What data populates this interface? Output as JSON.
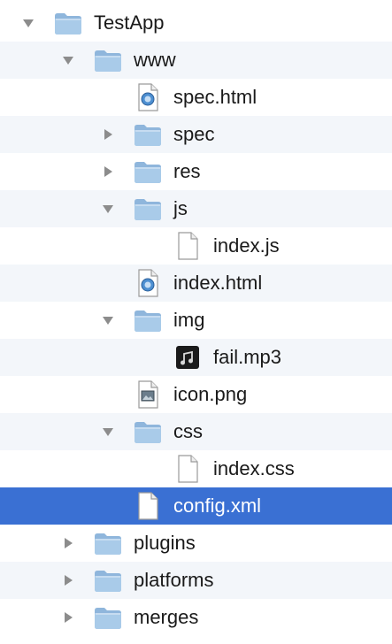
{
  "tree": [
    {
      "label": "TestApp",
      "level": 0,
      "kind": "folder",
      "state": "expanded"
    },
    {
      "label": "www",
      "level": 1,
      "kind": "folder",
      "state": "expanded"
    },
    {
      "label": "spec.html",
      "level": 2,
      "kind": "html-file",
      "state": "none"
    },
    {
      "label": "spec",
      "level": 2,
      "kind": "folder",
      "state": "collapsed"
    },
    {
      "label": "res",
      "level": 2,
      "kind": "folder",
      "state": "collapsed"
    },
    {
      "label": "js",
      "level": 2,
      "kind": "folder",
      "state": "expanded"
    },
    {
      "label": "index.js",
      "level": 3,
      "kind": "js-file",
      "state": "none"
    },
    {
      "label": "index.html",
      "level": 2,
      "kind": "html-file",
      "state": "none"
    },
    {
      "label": "img",
      "level": 2,
      "kind": "folder",
      "state": "expanded"
    },
    {
      "label": "fail.mp3",
      "level": 3,
      "kind": "audio-file",
      "state": "none"
    },
    {
      "label": "icon.png",
      "level": 2,
      "kind": "image-file",
      "state": "none"
    },
    {
      "label": "css",
      "level": 2,
      "kind": "folder",
      "state": "expanded"
    },
    {
      "label": "index.css",
      "level": 3,
      "kind": "css-file",
      "state": "none"
    },
    {
      "label": "config.xml",
      "level": 2,
      "kind": "xml-file",
      "state": "none",
      "selected": true
    },
    {
      "label": "plugins",
      "level": 1,
      "kind": "folder",
      "state": "collapsed"
    },
    {
      "label": "platforms",
      "level": 1,
      "kind": "folder",
      "state": "collapsed"
    },
    {
      "label": "merges",
      "level": 1,
      "kind": "folder",
      "state": "collapsed"
    }
  ],
  "colors": {
    "selection": "#3a70d3",
    "alternate_row": "#f3f6fa",
    "folder": "#a9cbe9",
    "disclosure": "#8c8c8c"
  }
}
